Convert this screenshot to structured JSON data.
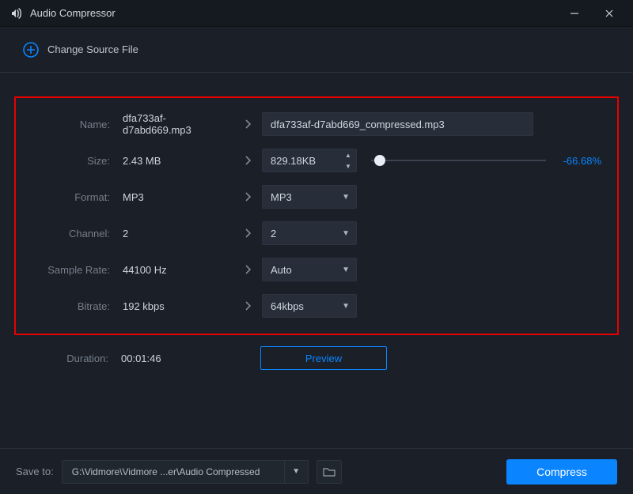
{
  "title": "Audio Compressor",
  "toolbar": {
    "change_source_label": "Change Source File"
  },
  "labels": {
    "name": "Name:",
    "size": "Size:",
    "format": "Format:",
    "channel": "Channel:",
    "sample_rate": "Sample Rate:",
    "bitrate": "Bitrate:",
    "duration": "Duration:",
    "save_to": "Save to:"
  },
  "source": {
    "name": "dfa733af-d7abd669.mp3",
    "size": "2.43 MB",
    "format": "MP3",
    "channel": "2",
    "sample_rate": "44100 Hz",
    "bitrate": "192 kbps",
    "duration": "00:01:46"
  },
  "target": {
    "name": "dfa733af-d7abd669_compressed.mp3",
    "size": "829.18KB",
    "size_pct": "-66.68%",
    "format": "MP3",
    "channel": "2",
    "sample_rate": "Auto",
    "bitrate": "64kbps"
  },
  "buttons": {
    "preview": "Preview",
    "compress": "Compress"
  },
  "footer": {
    "path": "G:\\Vidmore\\Vidmore ...er\\Audio Compressed"
  }
}
